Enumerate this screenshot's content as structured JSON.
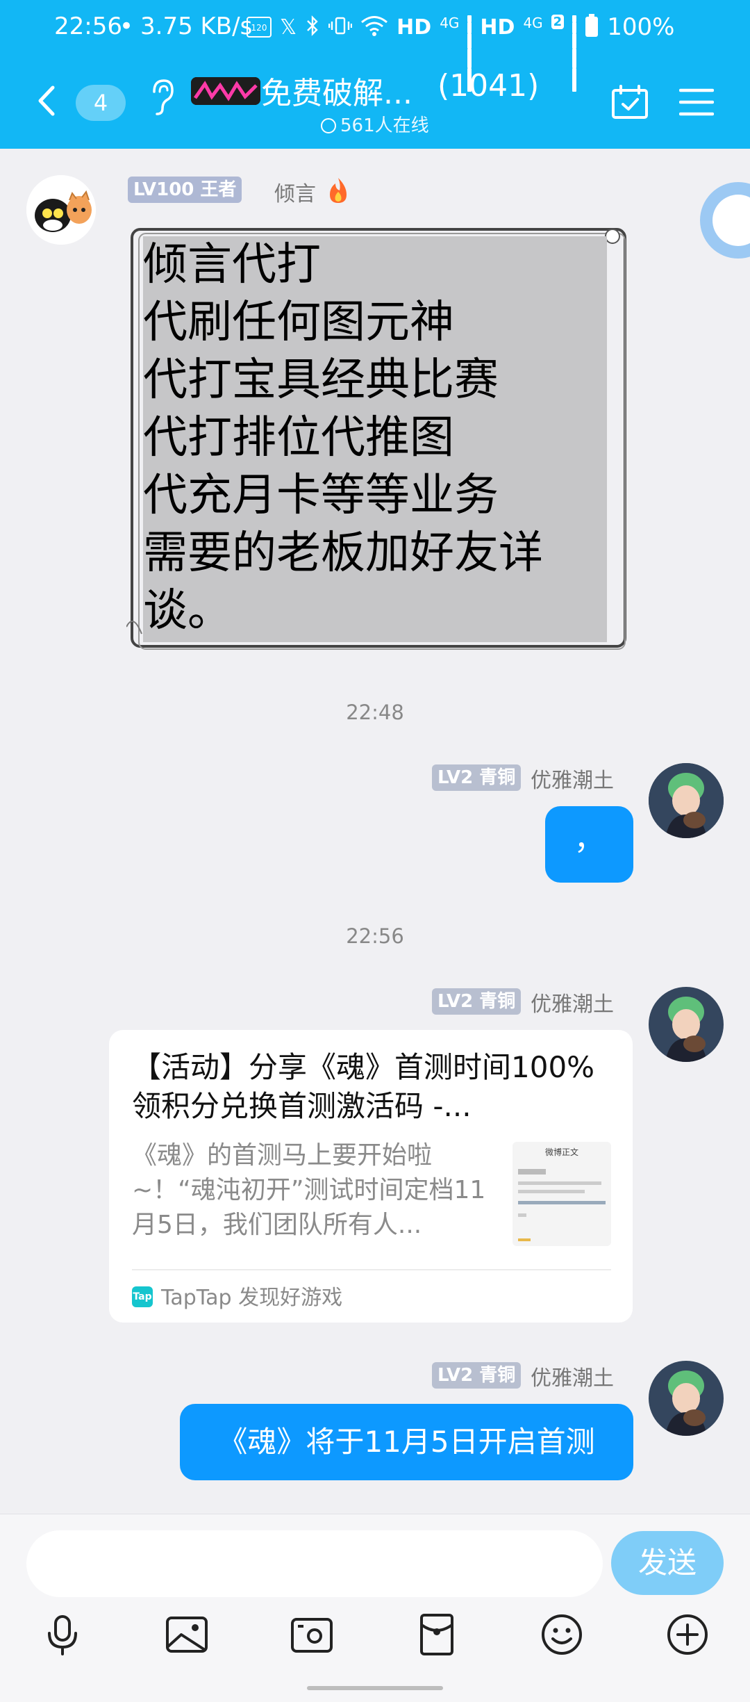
{
  "status_bar": {
    "time": "22:56",
    "speed": "3.75 KB/s",
    "network": "HD",
    "network_type": "4G",
    "sim_index": "2",
    "battery": "100%"
  },
  "header": {
    "unread_count": "4",
    "group_name": "免费破解...",
    "member_count": "(1041)",
    "online": "561人在线"
  },
  "messages": [
    {
      "sender": "倾言",
      "level_badge": "LV100 王者",
      "sticker_text": "      倾言代打\n代刷任何图元神\n代打宝具经典比赛\n代打排位代推图\n代充月卡等等业务\n需要的老板加好友详谈。"
    },
    {
      "time": "22:48"
    },
    {
      "sender": "优雅潮土",
      "level_badge": "LV2 青铜",
      "text": "，"
    },
    {
      "time": "22:56"
    },
    {
      "sender": "优雅潮土",
      "level_badge": "LV2 青铜",
      "card": {
        "title": "【活动】分享《魂》首测时间100%领积分兑换首测激活码 -...",
        "description": "《魂》的首测马上要开始啦~！“魂沌初开”测试时间定档11月5日，我们团队所有人...",
        "source": "TapTap 发现好游戏",
        "source_icon": "Tap",
        "thumb_heading": "微博正文"
      }
    },
    {
      "sender": "优雅潮土",
      "level_badge": "LV2 青铜",
      "text": "《魂》将于11月5日开启首测"
    }
  ],
  "composer": {
    "send_label": "发送",
    "tools": [
      "microphone-icon",
      "image-icon",
      "camera-icon",
      "red-packet-icon",
      "emoji-icon",
      "plus-icon"
    ]
  },
  "colors": {
    "header": "#12b7f5",
    "bubble": "#0d99ff",
    "send": "#7fcdf8"
  }
}
